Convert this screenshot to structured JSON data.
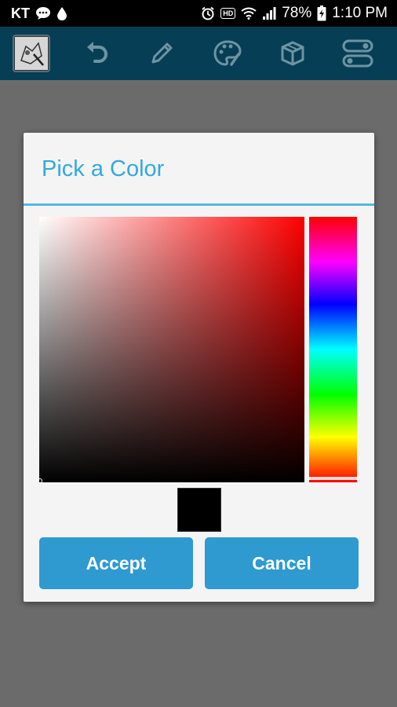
{
  "status_bar": {
    "carrier": "KT",
    "battery_percent": "78%",
    "time": "1:10 PM",
    "hd_label": "HD",
    "icons": [
      "chat-bubble-icon",
      "drop-icon",
      "alarm-icon",
      "hd-icon",
      "wifi-icon",
      "signal-icon",
      "battery-charging-icon"
    ]
  },
  "toolbar": {
    "items": [
      "thumbnail",
      "undo-icon",
      "pencil-icon",
      "palette-icon",
      "cube-icon",
      "toggle-settings-icon"
    ]
  },
  "dialog": {
    "title": "Pick a Color",
    "selected_hue": "#ff0000",
    "selected_color": "#000000",
    "accept_label": "Accept",
    "cancel_label": "Cancel",
    "accent_color": "#33aadf",
    "button_color": "#2e9ad0"
  }
}
